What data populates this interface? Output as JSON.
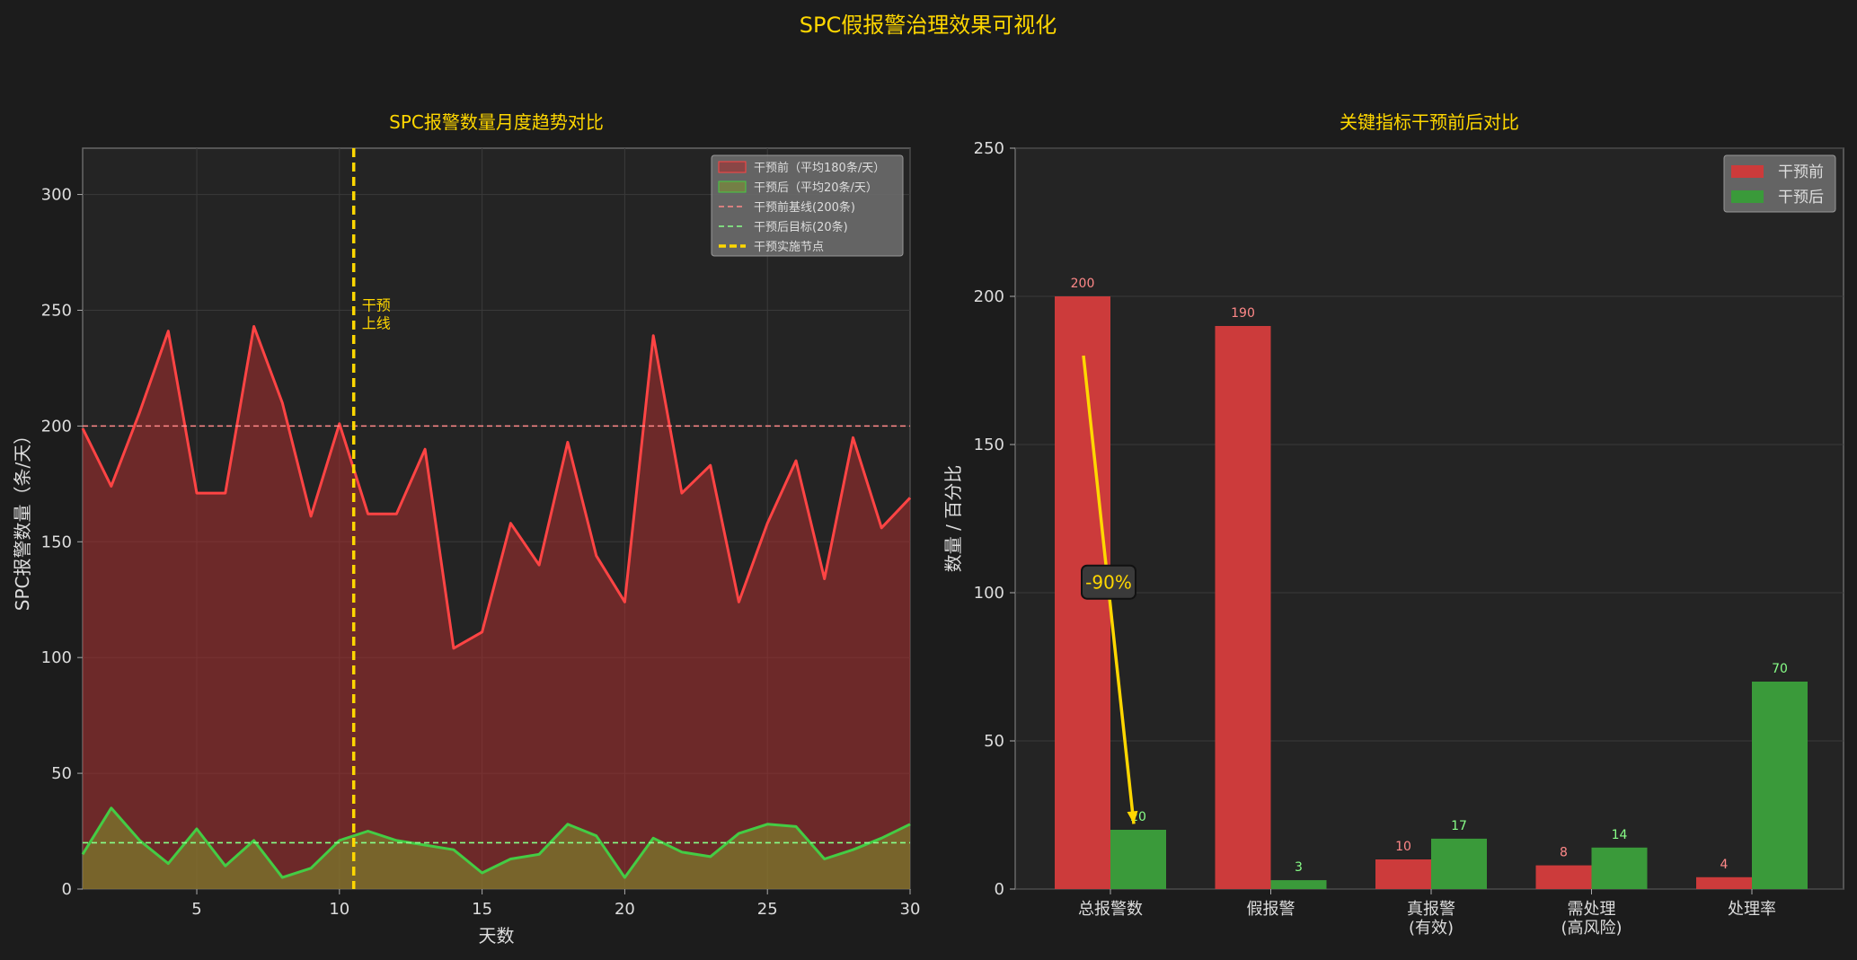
{
  "suptitle": "SPC假报警治理效果可视化",
  "colors": {
    "background": "#1c1c1c",
    "panel": "#242424",
    "accent": "#FFD700",
    "red": "#FF4444",
    "green": "#44CC44",
    "text": "#dddddd"
  },
  "chart_data": [
    {
      "type": "area",
      "title": "SPC报警数量月度趋势对比",
      "xlabel": "天数",
      "ylabel": "SPC报警数量（条/天）",
      "xlim": [
        1,
        30
      ],
      "ylim": [
        0,
        320
      ],
      "xticks": [
        5,
        10,
        15,
        20,
        25,
        30
      ],
      "yticks": [
        0,
        50,
        100,
        150,
        200,
        250,
        300
      ],
      "grid": true,
      "legend_position": "top-right",
      "x": [
        1,
        2,
        3,
        4,
        5,
        6,
        7,
        8,
        9,
        10,
        11,
        12,
        13,
        14,
        15,
        16,
        17,
        18,
        19,
        20,
        21,
        22,
        23,
        24,
        25,
        26,
        27,
        28,
        29,
        30
      ],
      "series": [
        {
          "name": "干预前（平均180条/天）",
          "color": "#FF4444",
          "values": [
            199,
            174,
            206,
            241,
            171,
            171,
            243,
            210,
            161,
            201,
            162,
            162,
            190,
            104,
            111,
            158,
            140,
            193,
            144,
            124,
            239,
            171,
            183,
            124,
            158,
            185,
            134,
            195,
            156,
            169
          ]
        },
        {
          "name": "干预后（平均20条/天）",
          "color": "#44CC44",
          "values": [
            15,
            35,
            21,
            11,
            26,
            10,
            21,
            5,
            9,
            21,
            25,
            21,
            19,
            17,
            7,
            13,
            15,
            28,
            23,
            5,
            22,
            16,
            14,
            24,
            28,
            27,
            13,
            17,
            22,
            28
          ]
        }
      ],
      "reference_lines": [
        {
          "name": "干预前基线(200条)",
          "y": 200,
          "color": "#FF8888"
        },
        {
          "name": "干预后目标(20条)",
          "y": 20,
          "color": "#88FF88"
        }
      ],
      "vline": {
        "name": "干预实施节点",
        "x": 10.5,
        "color": "#FFD700"
      },
      "annotation": {
        "line1": "干预",
        "line2": "上线",
        "x": 10.5,
        "y": 250
      }
    },
    {
      "type": "bar",
      "title": "关键指标干预前后对比",
      "ylabel": "数量 / 百分比",
      "categories": [
        [
          "总报警数"
        ],
        [
          "假报警"
        ],
        [
          "真报警",
          "(有效)"
        ],
        [
          "需处理",
          "(高风险)"
        ],
        [
          "处理率"
        ]
      ],
      "ylim": [
        0,
        250
      ],
      "yticks": [
        0,
        50,
        100,
        150,
        200,
        250
      ],
      "grid": true,
      "legend_position": "top-right",
      "series": [
        {
          "name": "干预前",
          "color": "#CC3B3B",
          "label_color": "#FF8888",
          "values": [
            200,
            190,
            10,
            8,
            4
          ]
        },
        {
          "name": "干预后",
          "color": "#3A9A3A",
          "label_color": "#88FF88",
          "values": [
            20,
            3,
            17,
            14,
            70
          ]
        }
      ],
      "annotation": {
        "text": "-90%",
        "from_value": 180,
        "to_value": 22
      }
    }
  ]
}
